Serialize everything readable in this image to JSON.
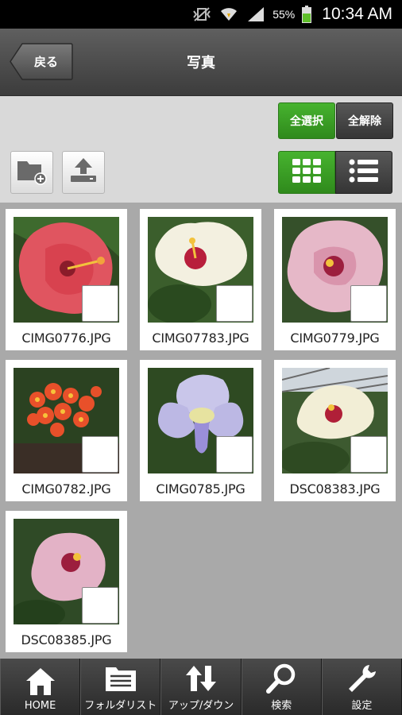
{
  "status_bar": {
    "battery": "55%",
    "time": "10:34 AM"
  },
  "header": {
    "back_label": "戻る",
    "title": "写真"
  },
  "toolbar": {
    "select_all": "全選択",
    "deselect_all": "全解除"
  },
  "files": [
    {
      "name": "CIMG0776.JPG",
      "photo": "red-hibiscus"
    },
    {
      "name": "CIMG07783.JPG",
      "photo": "white-hibiscus"
    },
    {
      "name": "CIMG0779.JPG",
      "photo": "pink-hibiscus"
    },
    {
      "name": "CIMG0782.JPG",
      "photo": "orange-flower-cluster"
    },
    {
      "name": "CIMG0785.JPG",
      "photo": "lavender-flower"
    },
    {
      "name": "DSC08383.JPG",
      "photo": "white-hibiscus-greenhouse"
    },
    {
      "name": "DSC08385.JPG",
      "photo": "pink-hibiscus"
    }
  ],
  "bottom_nav": [
    {
      "label": "HOME",
      "icon": "home-icon"
    },
    {
      "label": "フォルダリスト",
      "icon": "folder-list-icon"
    },
    {
      "label": "アップ/ダウン",
      "icon": "up-down-icon"
    },
    {
      "label": "検索",
      "icon": "search-icon"
    },
    {
      "label": "設定",
      "icon": "wrench-icon"
    }
  ],
  "colors": {
    "accent_green": "#3a9e24",
    "header_dark": "#4a4a4a"
  }
}
